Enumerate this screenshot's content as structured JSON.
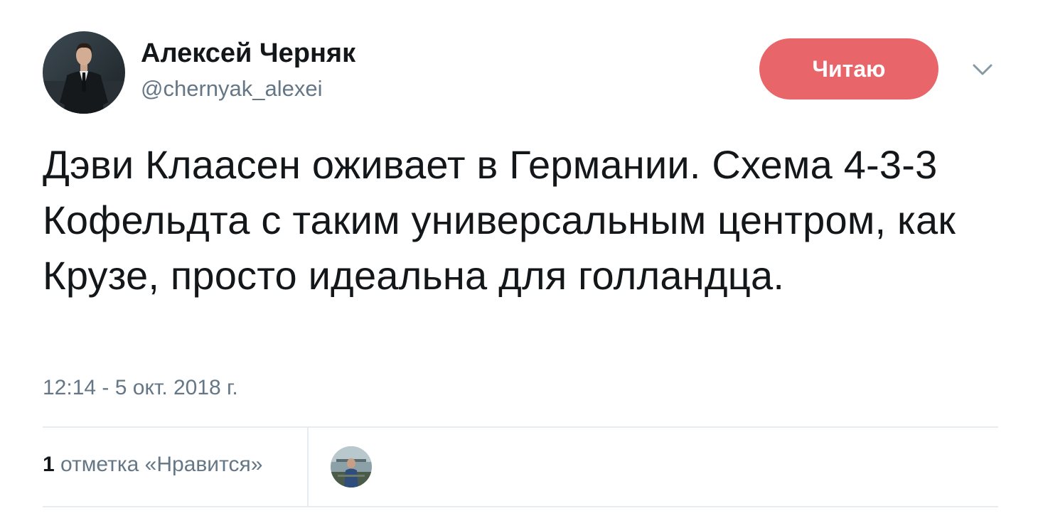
{
  "author": {
    "name": "Алексей Черняк",
    "handle": "@chernyak_alexei",
    "avatar_icon": "user-avatar"
  },
  "follow_button": {
    "label": "Читаю",
    "color": "#e8666a"
  },
  "menu": {
    "icon": "chevron-down-icon"
  },
  "tweet": {
    "text": "Дэви Клаасен оживает в Германии. Схема 4-3-3 Кофельдта с таким универсальным центром, как Крузе, просто идеальна для голландца."
  },
  "timestamp": "12:14 - 5 окт. 2018 г.",
  "engagement": {
    "like_count": "1",
    "like_label": "отметка «Нравится»",
    "liker_avatar_icon": "liker-avatar"
  }
}
